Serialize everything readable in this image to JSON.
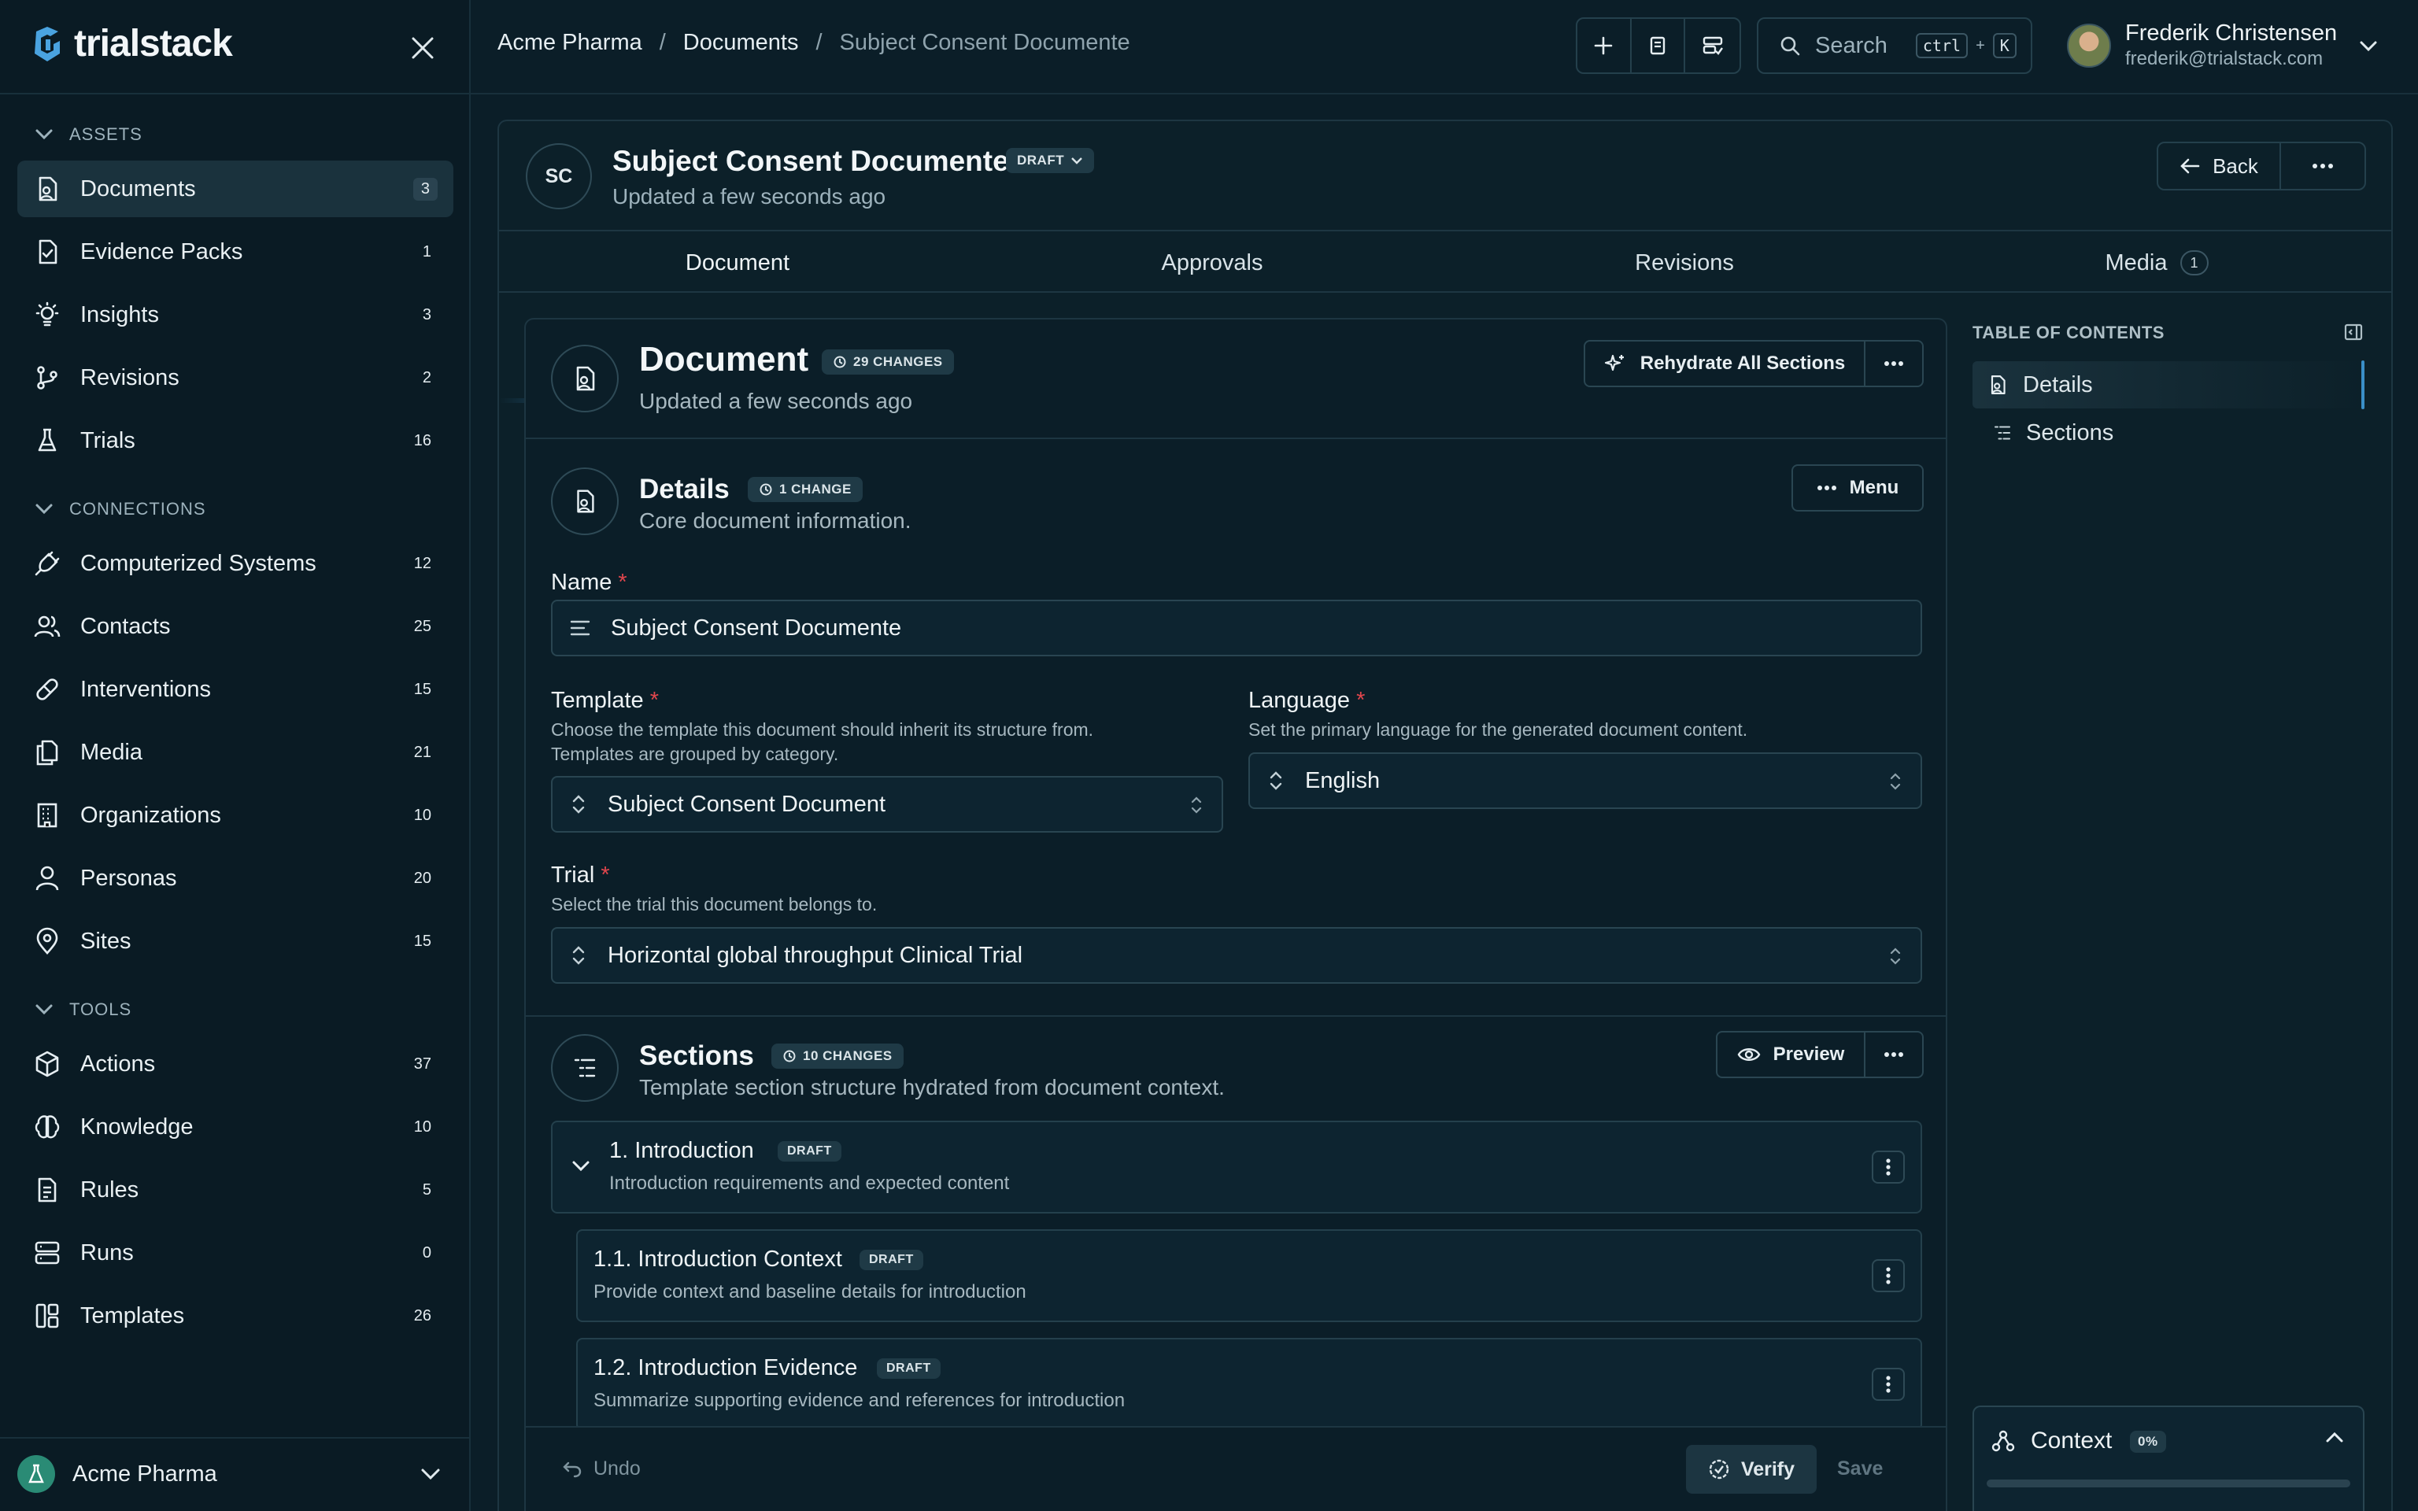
{
  "app": {
    "name": "trialstack"
  },
  "sidebar": {
    "sections": [
      {
        "title": "ASSETS",
        "items": [
          {
            "label": "Documents",
            "count": "3",
            "icon": "document-icon"
          },
          {
            "label": "Evidence Packs",
            "count": "1",
            "icon": "evidence-pack-icon"
          },
          {
            "label": "Insights",
            "count": "3",
            "icon": "lightbulb-icon"
          },
          {
            "label": "Revisions",
            "count": "2",
            "icon": "git-branch-icon"
          },
          {
            "label": "Trials",
            "count": "16",
            "icon": "flask-icon"
          }
        ]
      },
      {
        "title": "CONNECTIONS",
        "items": [
          {
            "label": "Computerized Systems",
            "count": "12",
            "icon": "plug-icon"
          },
          {
            "label": "Contacts",
            "count": "25",
            "icon": "users-icon"
          },
          {
            "label": "Interventions",
            "count": "15",
            "icon": "pill-icon"
          },
          {
            "label": "Media",
            "count": "21",
            "icon": "files-icon"
          },
          {
            "label": "Organizations",
            "count": "10",
            "icon": "building-icon"
          },
          {
            "label": "Personas",
            "count": "20",
            "icon": "user-icon"
          },
          {
            "label": "Sites",
            "count": "15",
            "icon": "map-pin-icon"
          }
        ]
      },
      {
        "title": "TOOLS",
        "items": [
          {
            "label": "Actions",
            "count": "37",
            "icon": "box-icon"
          },
          {
            "label": "Knowledge",
            "count": "10",
            "icon": "brain-icon"
          },
          {
            "label": "Rules",
            "count": "5",
            "icon": "rules-icon"
          },
          {
            "label": "Runs",
            "count": "0",
            "icon": "server-icon"
          },
          {
            "label": "Templates",
            "count": "26",
            "icon": "layout-icon"
          }
        ]
      }
    ],
    "org": "Acme Pharma"
  },
  "breadcrumb": [
    "Acme Pharma",
    "Documents",
    "Subject Consent Documente"
  ],
  "search": {
    "placeholder": "Search",
    "kbd1": "ctrl",
    "plus": "+",
    "kbd2": "K"
  },
  "user": {
    "name": "Frederik Christensen",
    "email": "frederik@trialstack.com"
  },
  "doc": {
    "initials": "SC",
    "title": "Subject Consent Documente",
    "status": "DRAFT",
    "updated": "Updated a few seconds ago",
    "back": "Back"
  },
  "tabs": [
    {
      "label": "Document"
    },
    {
      "label": "Approvals"
    },
    {
      "label": "Revisions"
    },
    {
      "label": "Media",
      "badge": "1"
    }
  ],
  "card": {
    "title": "Document",
    "changes": "29 CHANGES",
    "updated": "Updated a few seconds ago",
    "rehydrate": "Rehydrate All Sections"
  },
  "details": {
    "title": "Details",
    "changes": "1 CHANGE",
    "subtitle": "Core document information.",
    "menu": "Menu",
    "name_label": "Name",
    "name_value": "Subject Consent Documente",
    "template_label": "Template",
    "template_help": [
      "Choose the template this document should inherit its structure from.",
      "Templates are grouped by category."
    ],
    "template_value": "Subject Consent Document",
    "language_label": "Language",
    "language_help": "Set the primary language for the generated document content.",
    "language_value": "English",
    "trial_label": "Trial",
    "trial_help": "Select the trial this document belongs to.",
    "trial_value": "Horizontal global throughput Clinical Trial",
    "req": "*"
  },
  "sections": {
    "title": "Sections",
    "changes": "10 CHANGES",
    "subtitle": "Template section structure hydrated from document context.",
    "preview": "Preview",
    "items": [
      {
        "title": "1. Introduction",
        "badge": "DRAFT",
        "desc": "Introduction requirements and expected content"
      },
      {
        "title": "1.1. Introduction Context",
        "badge": "DRAFT",
        "desc": "Provide context and baseline details for introduction"
      },
      {
        "title": "1.2. Introduction Evidence",
        "badge": "DRAFT",
        "desc": "Summarize supporting evidence and references for introduction"
      }
    ]
  },
  "footer": {
    "undo": "Undo",
    "verify": "Verify",
    "save": "Save"
  },
  "toc": {
    "title": "TABLE OF CONTENTS",
    "items": [
      "Details",
      "Sections"
    ],
    "context_label": "Context",
    "context_pct": "0%"
  },
  "colors": {
    "accent": "#3a8fc8",
    "required": "#e0464d",
    "background": "#0b1e28"
  }
}
